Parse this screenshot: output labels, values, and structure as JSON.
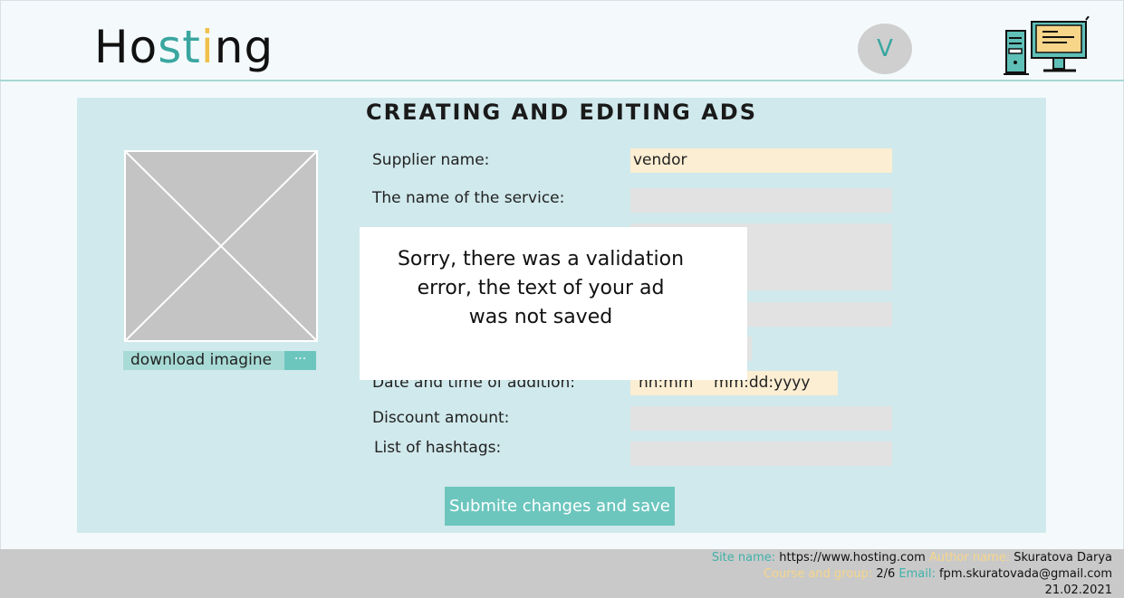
{
  "header": {
    "logo_part1": "Ho",
    "logo_part2": "st",
    "logo_part3": "i",
    "logo_part4": "ng",
    "avatar_letter": "V"
  },
  "page": {
    "title": "Creating and editing ads"
  },
  "image": {
    "download_label": "download imagine",
    "browse_label": "···"
  },
  "form": {
    "supplier_label": "Supplier name:",
    "supplier_value": "vendor",
    "service_label": "The name of the service:",
    "date_label": "Date and time of addition:",
    "time_placeholder": "hh:mm",
    "date_placeholder": "mm:dd:yyyy",
    "discount_label": "Discount amount:",
    "hashtags_label": "List of hashtags:",
    "submit_label": "Submite changes and save"
  },
  "modal": {
    "message": "Sorry, there was a validation error, the text of your ad was not saved"
  },
  "footer": {
    "site_key": "Site name:",
    "site_value": "https://www.hosting.com",
    "author_key": "Author name:",
    "author_value": "Skuratova Darya",
    "course_key": "Course and group:",
    "course_value": "2/6",
    "email_key": "Email:",
    "email_value": "fpm.skuratovada@gmail.com",
    "date": "21.02.2021"
  },
  "colors": {
    "accent_teal": "#3aa6a0",
    "accent_yellow": "#f0c04a",
    "card_bg": "#d0e9ec",
    "button_bg": "#6cc6be"
  }
}
